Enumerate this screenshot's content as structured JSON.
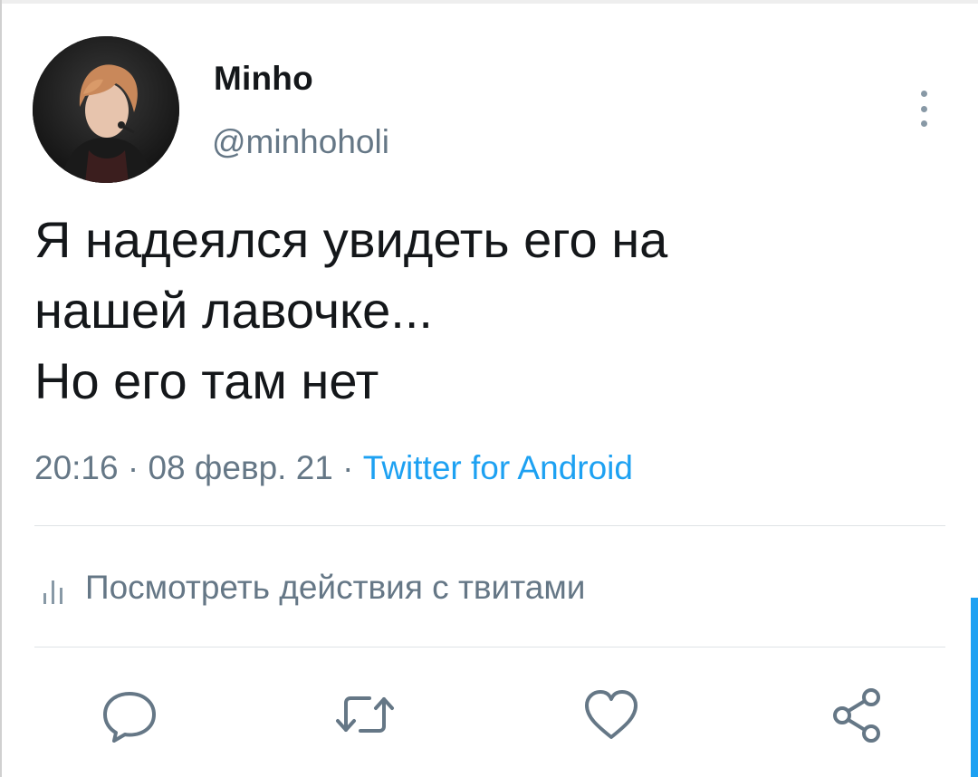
{
  "user": {
    "display_name": "Minho",
    "handle": "@minhoholi"
  },
  "tweet": {
    "lines": [
      "Я надеялся увидеть его на",
      "нашей лавочке...",
      "Но его там нет"
    ],
    "time": "20:16",
    "separator": "·",
    "date": "08 февр. 21",
    "source": "Twitter for Android"
  },
  "activity": {
    "label": "Посмотреть действия с твитами",
    "icon": "bar-chart-icon"
  },
  "actions": [
    {
      "icon": "reply-icon"
    },
    {
      "icon": "retweet-icon"
    },
    {
      "icon": "like-icon"
    },
    {
      "icon": "share-icon"
    }
  ],
  "colors": {
    "text": "#14171a",
    "secondary": "#657786",
    "accent": "#1da1f2",
    "divider": "#dfe3e6"
  }
}
